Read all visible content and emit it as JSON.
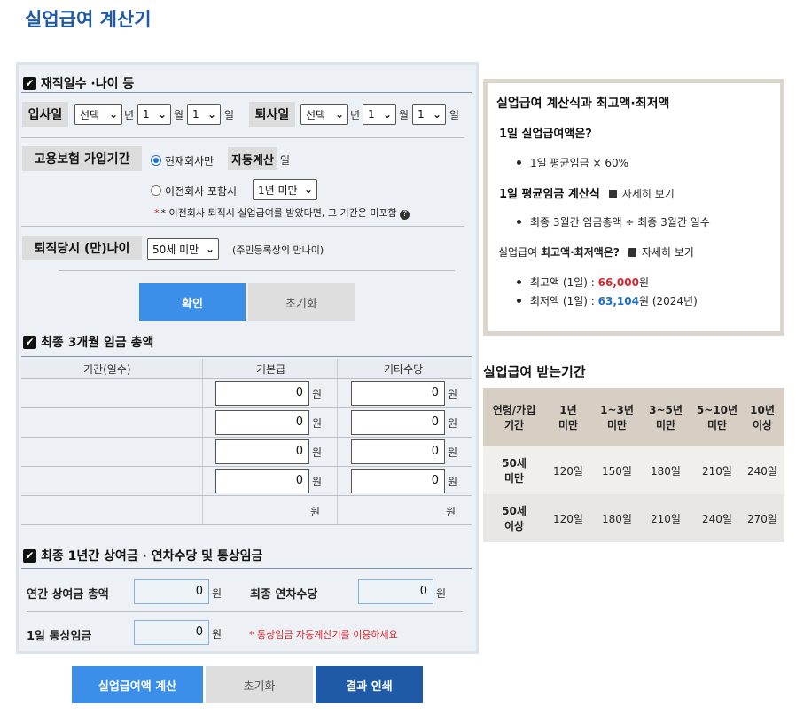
{
  "title": "실업급여 계산기",
  "section1": {
    "header": "재직일수 ·나이 등",
    "join_label": "입사일",
    "leave_label": "퇴사일",
    "select_choice": "선택",
    "month_value": "1",
    "day_value": "1",
    "unit_year": "년",
    "unit_month": "월",
    "unit_day": "일",
    "insurance_label": "고용보험 가입기간",
    "radio_current": "현재회사만",
    "auto_calc": "자동계산",
    "auto_unit": "일",
    "radio_prev": "이전회사 포함시",
    "prev_period": "1년 미만",
    "prev_note": "* 이전회사 퇴직시 실업급여를 받았다면, 그 기간은 미포함",
    "age_label": "퇴직당시 (만)나이",
    "age_value": "50세 미만",
    "age_note": "(주민등록상의 만나이)",
    "confirm_btn": "확인",
    "reset_btn": "초기화"
  },
  "section2": {
    "header": "최종 3개월 임금 총액",
    "col_period": "기간(일수)",
    "col_base": "기본급",
    "col_other": "기타수당",
    "rows": [
      {
        "base": "0",
        "other": "0"
      },
      {
        "base": "0",
        "other": "0"
      },
      {
        "base": "0",
        "other": "0"
      },
      {
        "base": "0",
        "other": "0"
      }
    ],
    "unit_won": "원"
  },
  "section3": {
    "header": "최종 1년간 상여금 · 연차수당 및 통상임금",
    "bonus_label": "연간 상여금 총액",
    "bonus_value": "0",
    "annual_label": "최종 연차수당",
    "annual_value": "0",
    "daily_label": "1일 통상임금",
    "daily_value": "0",
    "daily_note": "* 통상임금 자동계산기를 이용하세요",
    "unit_won": "원"
  },
  "bottom_buttons": {
    "calc": "실업급여액 계산",
    "reset": "초기화",
    "print": "결과 인쇄"
  },
  "formula": {
    "title": "실업급여 계산식과 최고액·최저액",
    "q1": "1일 실업급여액은?",
    "a1": "1일 평균임금 × 60%",
    "q2": "1일 평균임금 계산식",
    "detail_link": "자세히 보기",
    "a2": "최종 3월간 임금총액 ÷ 최종 3월간 일수",
    "q3_prefix": "실업급여",
    "q3_bold": "최고액·최저액은?",
    "max_prefix": "최고액 (1일) : ",
    "max_value": "66,000",
    "max_suffix": "원",
    "min_prefix": "최저액 (1일) : ",
    "min_value": "63,104",
    "min_suffix": "원 (2024년)"
  },
  "period": {
    "title": "실업급여 받는기간",
    "head_col0": "연령/가입\n기간",
    "headers": [
      "1년\n미만",
      "1~3년\n미만",
      "3~5년\n미만",
      "5~10년\n미만",
      "10년\n이상"
    ],
    "rows": [
      {
        "label": "50세\n미만",
        "values": [
          "120일",
          "150일",
          "180일",
          "210일",
          "240일"
        ]
      },
      {
        "label": "50세\n이상",
        "values": [
          "120일",
          "180일",
          "210일",
          "240일",
          "270일"
        ]
      }
    ]
  },
  "colors": {
    "title_blue": "#1f5aa6",
    "primary_button": "#3b8fe8",
    "max_red": "#d8262b",
    "min_blue": "#1f6fc7"
  }
}
